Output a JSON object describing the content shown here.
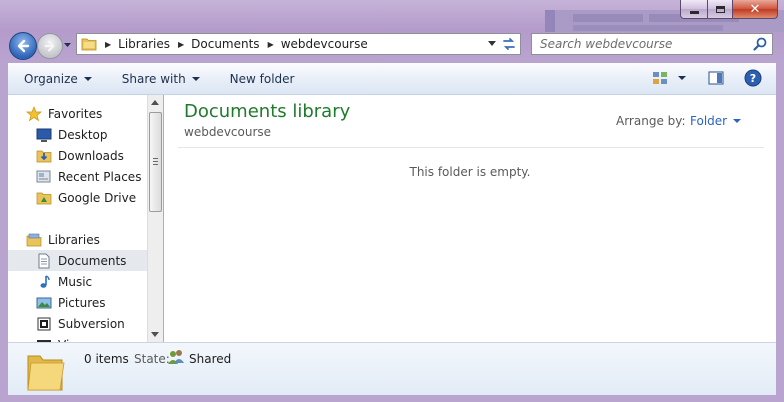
{
  "titlebar": {
    "window_buttons": {
      "minimize_icon": "minimize-icon",
      "maximize_icon": "maximize-icon",
      "close_icon": "close-icon"
    }
  },
  "navigation": {
    "breadcrumbs": [
      "Libraries",
      "Documents",
      "webdevcourse"
    ]
  },
  "search": {
    "placeholder": "Search webdevcourse"
  },
  "toolbar": {
    "organize_label": "Organize",
    "share_label": "Share with",
    "newfolder_label": "New folder"
  },
  "sidebar": {
    "favorites": {
      "label": "Favorites",
      "items": [
        {
          "label": "Desktop",
          "icon": "desktop-icon"
        },
        {
          "label": "Downloads",
          "icon": "downloads-folder-icon"
        },
        {
          "label": "Recent Places",
          "icon": "recent-places-icon"
        },
        {
          "label": "Google Drive",
          "icon": "google-drive-folder-icon"
        }
      ]
    },
    "libraries": {
      "label": "Libraries",
      "items": [
        {
          "label": "Documents",
          "icon": "documents-icon",
          "selected": true
        },
        {
          "label": "Music",
          "icon": "music-icon"
        },
        {
          "label": "Pictures",
          "icon": "pictures-icon"
        },
        {
          "label": "Subversion",
          "icon": "subversion-icon"
        },
        {
          "label": "Vi",
          "icon": "videos-icon"
        }
      ]
    }
  },
  "content": {
    "title": "Documents library",
    "subtitle": "webdevcourse",
    "arrange_label": "Arrange by:",
    "arrange_value": "Folder",
    "empty_message": "This folder is empty."
  },
  "details": {
    "items_count": "0 items",
    "state_label": "State:",
    "state_value": "Shared"
  },
  "colors": {
    "library_title": "#1e7b2c",
    "link_blue": "#2a64c5",
    "frame": "#b9a3cf"
  }
}
